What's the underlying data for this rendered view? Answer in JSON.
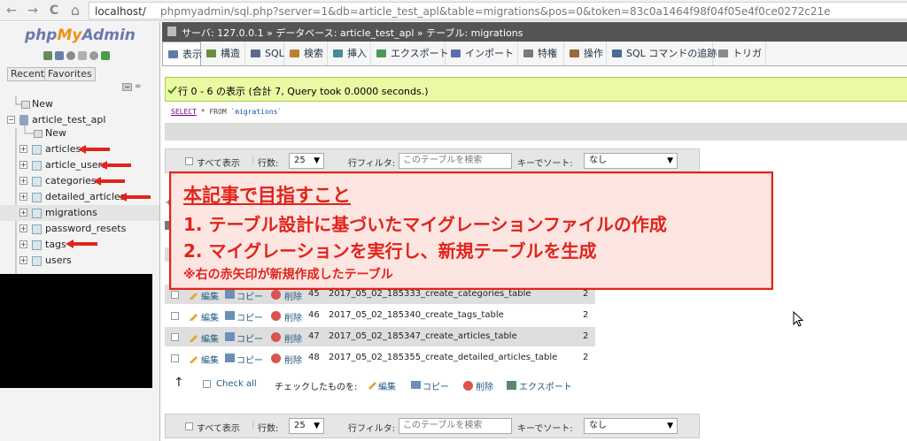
{
  "browser": {
    "url_host": "localhost/",
    "url_path": "phpmyadmin/sql.php?server=1&db=article_test_apl&table=migrations&pos=0&token=83c0a1464f98f04f05e4f0ce0272c21e",
    "back_glyph": "←",
    "forward_glyph": "→",
    "reload_glyph": "C",
    "home_glyph": "⌂"
  },
  "sidebar": {
    "logo_php": "php",
    "logo_my": "My",
    "logo_admin": "Admin",
    "recent_label": "Recent",
    "favorites_label": "Favorites",
    "collapse_label": "−",
    "link_label": "∞",
    "tree": {
      "new_root": "New",
      "db_name": "article_test_apl",
      "new_db": "New",
      "tables": [
        "articles",
        "article_users",
        "categories",
        "detailed_articles",
        "migrations",
        "password_resets",
        "tags",
        "users"
      ]
    }
  },
  "breadcrumb": {
    "server": "サーバ: 127.0.0.1",
    "sep1": "»",
    "database": "データベース: article_test_apl",
    "sep2": "»",
    "table": "テーブル: migrations"
  },
  "tabs": [
    "表示",
    "構造",
    "SQL",
    "検索",
    "挿入",
    "エクスポート",
    "インポート",
    "特権",
    "操作",
    "SQL コマンドの追跡",
    "トリガ"
  ],
  "success_message": "行 0 - 6 の表示 (合計 7, Query took 0.0000 seconds.)",
  "sql": {
    "select": "SELECT",
    "rest": "* FROM",
    "table": "`migrations`"
  },
  "nav": {
    "show_all": "すべて表示",
    "rows_label": "行数:",
    "rows_value": "25",
    "filter_label": "行フィルタ:",
    "filter_placeholder": "このテーブルを検索",
    "sort_label": "キーでソート:",
    "sort_value": "なし"
  },
  "row_actions": {
    "edit": "編集",
    "copy": "コピー",
    "delete": "削除"
  },
  "rows": [
    {
      "id": "45",
      "migration": "2017_05_02_185333_create_categories_table",
      "batch": "2"
    },
    {
      "id": "46",
      "migration": "2017_05_02_185340_create_tags_table",
      "batch": "2"
    },
    {
      "id": "47",
      "migration": "2017_05_02_185347_create_articles_table",
      "batch": "2"
    },
    {
      "id": "48",
      "migration": "2017_05_02_185355_create_detailed_articles_table",
      "batch": "2"
    }
  ],
  "bulk": {
    "arrow": "↑",
    "check_all": "Check all",
    "with_selected": "チェックしたものを:",
    "edit": "編集",
    "copy": "コピー",
    "delete": "削除",
    "export": "エクスポート"
  },
  "annotation": {
    "title": "本記事で目指すこと",
    "line1": "1. テーブル設計に基づいたマイグレーションファイルの作成",
    "line2": "2. マイグレーションを実行し、新規テーブルを生成",
    "note": "※右の赤矢印が新規作成したテーブル"
  },
  "colors": {
    "annotation_red": "#e0241c",
    "annotation_bg": "#fde5e1",
    "success_bg": "#ebf8a4",
    "breadcrumb_bg": "#555555",
    "link_blue": "#235a81"
  }
}
